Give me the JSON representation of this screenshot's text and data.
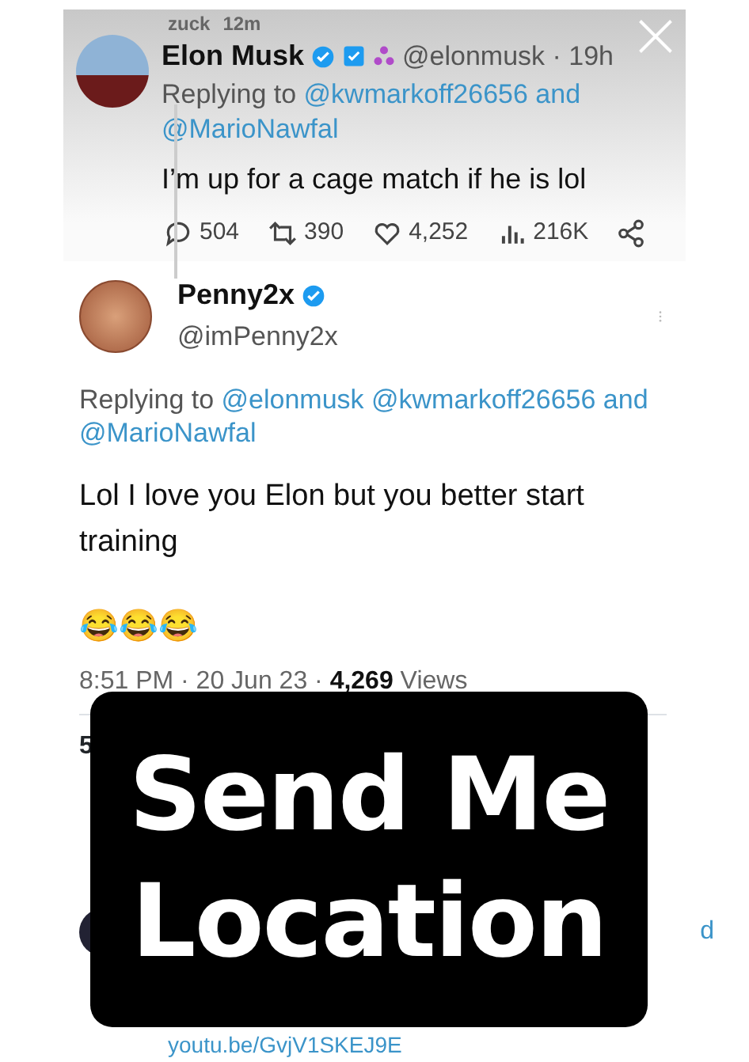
{
  "story_header": {
    "user": "zuck",
    "time": "12m"
  },
  "parent_tweet": {
    "name": "Elon Musk",
    "handle": "@elonmusk · 19h",
    "replying_label": "Replying to",
    "replying_to": "@kwmarkoff26656 and @MarioNawfal",
    "text": "I’m up for a cage match if he is lol",
    "actions": [
      {
        "kind": "reply",
        "count": "504"
      },
      {
        "kind": "retweet",
        "count": "390"
      },
      {
        "kind": "like",
        "count": "4,252"
      },
      {
        "kind": "views",
        "count": "216K"
      },
      {
        "kind": "share"
      }
    ]
  },
  "main_tweet": {
    "name": "Penny2x",
    "handle": "@imPenny2x",
    "replying_label": "Replying to",
    "replying_to": "@elonmusk @kwmarkoff26656 and @MarioNawfal",
    "text": "Lol I love you Elon but you better start training",
    "emoji": "😂😂😂",
    "meta": "8:51 PM · 20 Jun 23 · **4,269** Views"
  },
  "stats_peek": "5",
  "next_reply": {
    "edge_text": "d",
    "link": "youtu.be/GvjV1SKEJ9E"
  },
  "sticker": {
    "lines": [
      "Send Me",
      "Location"
    ]
  }
}
